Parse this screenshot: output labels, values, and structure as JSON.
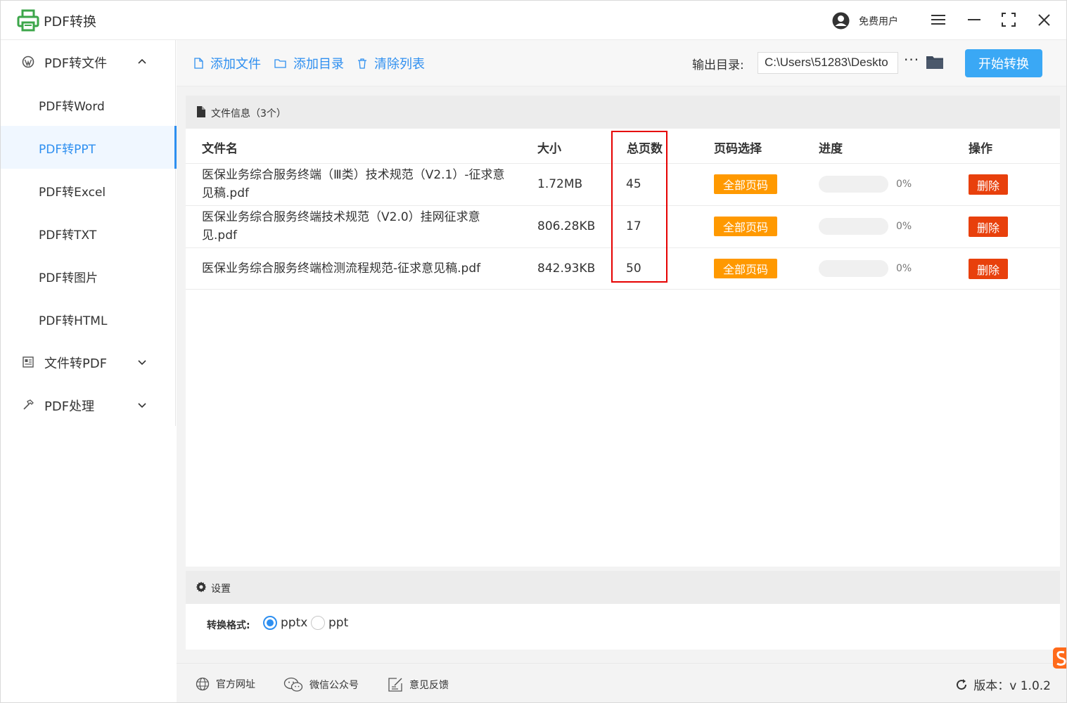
{
  "app": {
    "title": "PDF转换",
    "user": "免费用户"
  },
  "sidebar": {
    "groups": [
      {
        "label": "PDF转文件",
        "icon": "wordpress-icon",
        "expanded": true
      },
      {
        "label": "文件转PDF",
        "icon": "document-list-icon",
        "expanded": false
      },
      {
        "label": "PDF处理",
        "icon": "hammer-icon",
        "expanded": false
      }
    ],
    "items": [
      {
        "label": "PDF转Word"
      },
      {
        "label": "PDF转PPT",
        "active": true
      },
      {
        "label": "PDF转Excel"
      },
      {
        "label": "PDF转TXT"
      },
      {
        "label": "PDF转图片"
      },
      {
        "label": "PDF转HTML"
      }
    ]
  },
  "toolbar": {
    "add_file": "添加文件",
    "add_dir": "添加目录",
    "clear_list": "清除列表",
    "output_label": "输出目录:",
    "output_path": "C:\\Users\\51283\\Deskto",
    "more": "···",
    "start": "开始转换"
  },
  "file_panel": {
    "header": "文件信息（3个）",
    "columns": [
      "文件名",
      "大小",
      "总页数",
      "页码选择",
      "进度",
      "操作"
    ],
    "rows": [
      {
        "name": "医保业务综合服务终端（Ⅲ类）技术规范（V2.1）-征求意见稿.pdf",
        "size": "1.72MB",
        "pages": "45",
        "page_select": "全部页码",
        "progress": 0,
        "progress_text": "0%",
        "action": "删除"
      },
      {
        "name": "医保业务综合服务终端技术规范（V2.0）挂网征求意见.pdf",
        "size": "806.28KB",
        "pages": "17",
        "page_select": "全部页码",
        "progress": 0,
        "progress_text": "0%",
        "action": "删除"
      },
      {
        "name": "医保业务综合服务终端检测流程规范-征求意见稿.pdf",
        "size": "842.93KB",
        "pages": "50",
        "page_select": "全部页码",
        "progress": 0,
        "progress_text": "0%",
        "action": "删除"
      }
    ]
  },
  "settings": {
    "header": "设置",
    "format_label": "转换格式:",
    "options": [
      {
        "label": "pptx",
        "selected": true
      },
      {
        "label": "ppt",
        "selected": false
      }
    ]
  },
  "footer": {
    "website": "官方网址",
    "wechat": "微信公众号",
    "feedback": "意见反馈",
    "version": "版本：v 1.0.2"
  },
  "colors": {
    "accent": "#2e8ff0",
    "start_button": "#3aa8f5",
    "page_badge": "#ff9900",
    "delete_button": "#e8400c",
    "highlight": "#e60000",
    "logo": "#3ca64a"
  }
}
